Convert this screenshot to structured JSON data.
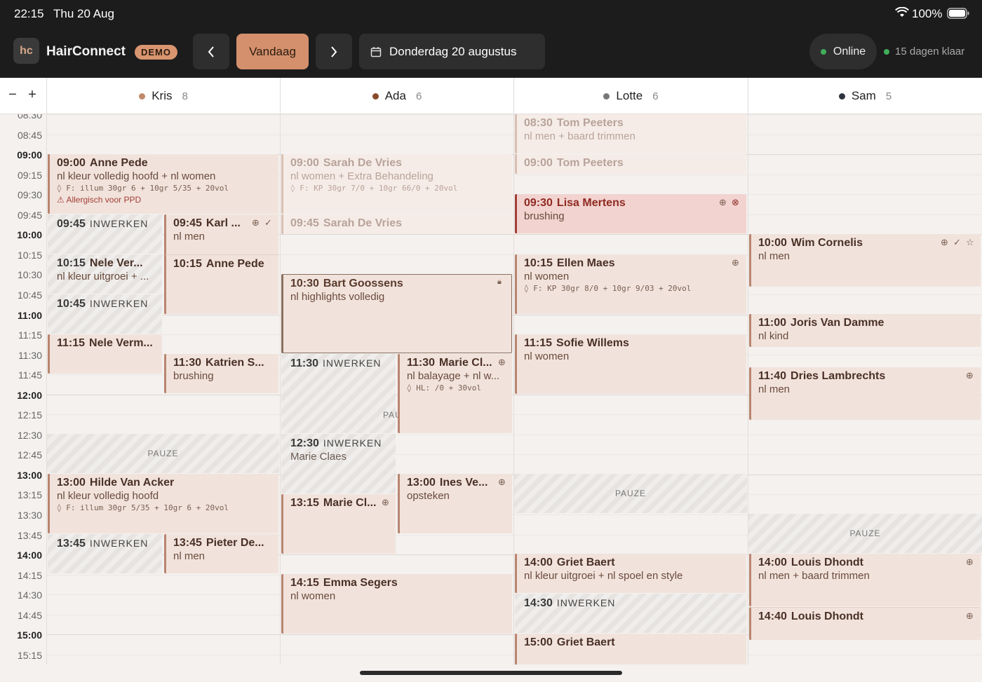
{
  "status": {
    "time": "22:15",
    "date": "Thu 20 Aug",
    "battery": "100%",
    "wifi_icon": "wifi-icon",
    "battery_icon": "battery-icon"
  },
  "header": {
    "logo": "hc",
    "app_name": "HairConnect",
    "badge": "DEMO",
    "prev": "‹",
    "today": "Vandaag",
    "next": "›",
    "date_label": "Donderdag 20 augustus",
    "online": "Online",
    "license": "15 dagen klaar"
  },
  "zoom": {
    "minus": "−",
    "plus": "+"
  },
  "staff": [
    {
      "name": "Kris",
      "count": "8",
      "color": "#c08a6c"
    },
    {
      "name": "Ada",
      "count": "6",
      "color": "#8a4a2c"
    },
    {
      "name": "Lotte",
      "count": "6",
      "color": "#777777"
    },
    {
      "name": "Sam",
      "count": "5",
      "color": "#2c3440"
    }
  ],
  "times": [
    "08:30",
    "08:45",
    "09:00",
    "09:15",
    "09:30",
    "09:45",
    "10:00",
    "10:15",
    "10:30",
    "10:45",
    "11:00",
    "11:15",
    "11:30",
    "11:45",
    "12:00",
    "12:15",
    "12:30",
    "12:45",
    "13:00",
    "13:15",
    "13:30",
    "13:45",
    "14:00",
    "14:15",
    "14:30",
    "14:45",
    "15:00",
    "15:15"
  ],
  "appointments": {
    "kris_anne": {
      "time": "09:00",
      "name": "Anne Pede",
      "service": "nl kleur volledig hoofd + nl women",
      "formula": "F: illum 30gr 6 + 10gr 5/35 + 20vol",
      "warning": "Allergisch voor PPD"
    },
    "kris_werk1": {
      "time": "09:45",
      "label": "INWERKEN"
    },
    "kris_karl": {
      "time": "09:45",
      "name": "Karl ...",
      "service": "nl men"
    },
    "kris_nele1": {
      "time": "10:15",
      "name": "Nele Ver...",
      "service": "nl kleur uitgroei + ..."
    },
    "kris_anne2": {
      "time": "10:15",
      "name": "Anne Pede"
    },
    "kris_werk2": {
      "time": "10:45",
      "label": "INWERKEN"
    },
    "kris_nele2": {
      "time": "11:15",
      "name": "Nele Verm..."
    },
    "kris_katrien": {
      "time": "11:30",
      "name": "Katrien S...",
      "service": "brushing"
    },
    "kris_pauze": {
      "label": "PAUZE"
    },
    "kris_hilde": {
      "time": "13:00",
      "name": "Hilde Van Acker",
      "service": "nl kleur volledig hoofd",
      "formula": "F: illum 30gr 5/35 + 10gr 6 + 20vol"
    },
    "kris_werk3": {
      "time": "13:45",
      "label": "INWERKEN"
    },
    "kris_pieter": {
      "time": "13:45",
      "name": "Pieter De...",
      "service": "nl men"
    },
    "ada_sarah": {
      "time": "09:00",
      "name": "Sarah De Vries",
      "service": "nl women + Extra Behandeling",
      "formula": "F: KP 30gr 7/0 + 10gr 66/0 + 20vol"
    },
    "ada_sarah2": {
      "time": "09:45",
      "name": "Sarah De Vries"
    },
    "ada_bart": {
      "time": "10:30",
      "name": "Bart Goossens",
      "service": "nl highlights volledig"
    },
    "ada_werk1": {
      "time": "11:30",
      "label": "INWERKEN",
      "pauze": "PAU"
    },
    "ada_marie1": {
      "time": "11:30",
      "name": "Marie Cl...",
      "service": "nl balayage + nl w...",
      "formula": "HL: /0 + 30vol"
    },
    "ada_werk2": {
      "time": "12:30",
      "label": "INWERKEN",
      "sub": "Marie Claes"
    },
    "ada_marie2": {
      "time": "13:15",
      "name": "Marie Cl..."
    },
    "ada_ines": {
      "time": "13:00",
      "name": "Ines Ve...",
      "service": "opsteken"
    },
    "ada_emma": {
      "time": "14:15",
      "name": "Emma Segers",
      "service": "nl women"
    },
    "lotte_tom1": {
      "time": "08:30",
      "name": "Tom Peeters",
      "service": "nl men + baard trimmen"
    },
    "lotte_tom2": {
      "time": "09:00",
      "name": "Tom Peeters"
    },
    "lotte_lisa": {
      "time": "09:30",
      "name": "Lisa Mertens",
      "service": "brushing"
    },
    "lotte_ellen": {
      "time": "10:15",
      "name": "Ellen Maes",
      "service": "nl women",
      "formula": "F: KP 30gr 8/0 + 10gr 9/03 + 20vol"
    },
    "lotte_sofie": {
      "time": "11:15",
      "name": "Sofie Willems",
      "service": "nl women"
    },
    "lotte_pauze": {
      "label": "PAUZE"
    },
    "lotte_griet": {
      "time": "14:00",
      "name": "Griet Baert",
      "service": "nl kleur uitgroei + nl spoel en style"
    },
    "lotte_werk": {
      "time": "14:30",
      "label": "INWERKEN"
    },
    "lotte_griet2": {
      "time": "15:00",
      "name": "Griet Baert"
    },
    "sam_wim": {
      "time": "10:00",
      "name": "Wim Cornelis",
      "service": "nl men"
    },
    "sam_joris": {
      "time": "11:00",
      "name": "Joris Van Damme",
      "service": "nl kind"
    },
    "sam_dries": {
      "time": "11:40",
      "name": "Dries Lambrechts",
      "service": "nl men"
    },
    "sam_pauze": {
      "label": "PAUZE"
    },
    "sam_louis1": {
      "time": "14:00",
      "name": "Louis Dhondt",
      "service": "nl men + baard trimmen"
    },
    "sam_louis2": {
      "time": "14:40",
      "name": "Louis Dhondt"
    }
  },
  "icons": {
    "globe": "globe-icon",
    "check": "check-icon",
    "star": "star-icon",
    "lock": "lock-icon",
    "cancel": "cancel-icon",
    "drop": "drop-icon",
    "warning": "warning-icon",
    "calendar": "calendar-icon"
  }
}
